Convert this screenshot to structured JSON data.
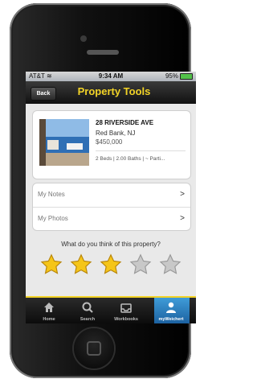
{
  "status_bar": {
    "carrier": "AT&T",
    "time": "9:34 AM",
    "battery": "95%"
  },
  "nav": {
    "back_label": "Back",
    "title": "Property Tools"
  },
  "property": {
    "address": "28 RIVERSIDE AVE",
    "city": "Red Bank, NJ",
    "price": "$450,000",
    "details": "2 Beds | 2.00 Baths | ~ Parti..."
  },
  "menu": {
    "items": [
      {
        "label": "My Notes"
      },
      {
        "label": "My Photos"
      }
    ]
  },
  "rating": {
    "question": "What do you think of this property?",
    "value": 3,
    "max": 5
  },
  "tabs": [
    {
      "label": "Home",
      "icon": "home-icon"
    },
    {
      "label": "Search",
      "icon": "search-icon"
    },
    {
      "label": "Workbooks",
      "icon": "inbox-icon"
    },
    {
      "label": "myWeichert",
      "icon": "user-icon",
      "active": true
    }
  ],
  "colors": {
    "accent_yellow": "#f2d326",
    "active_tab_blue": "#2a7fc4",
    "star_filled": "#f5c518",
    "star_empty": "#c8c8c8"
  }
}
